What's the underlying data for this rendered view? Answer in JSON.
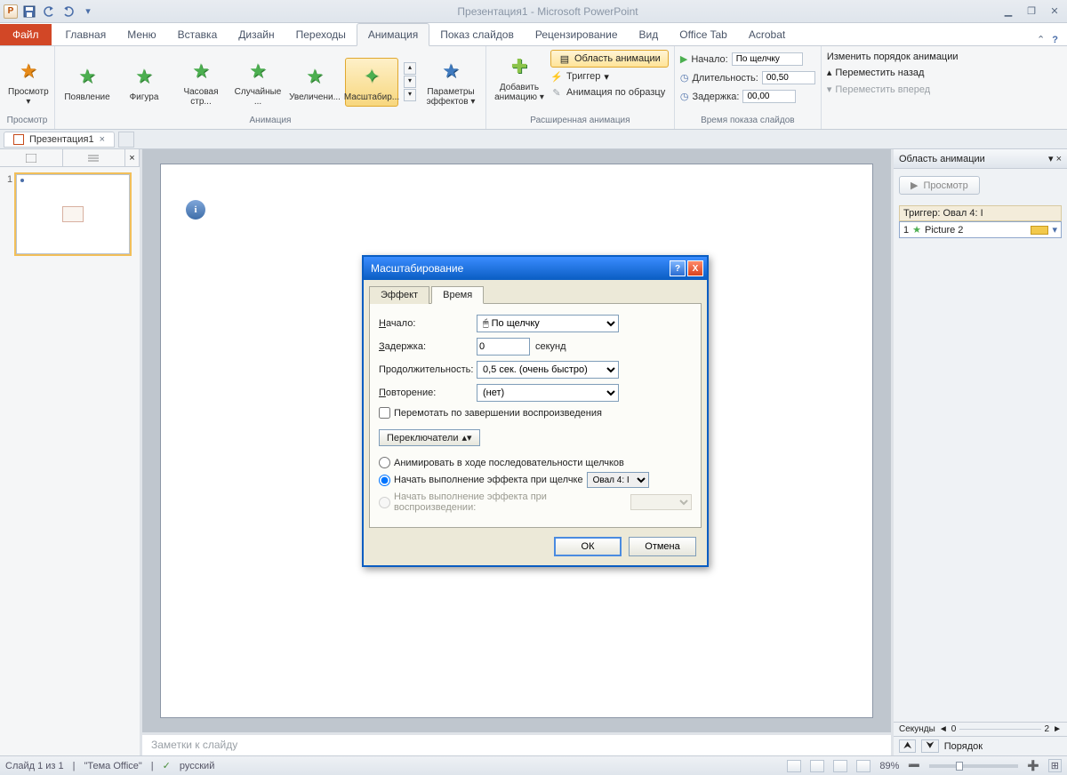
{
  "title": "Презентация1  -  Microsoft PowerPoint",
  "ribbon": {
    "file": "Файл",
    "tabs": [
      "Главная",
      "Меню",
      "Вставка",
      "Дизайн",
      "Переходы",
      "Анимация",
      "Показ слайдов",
      "Рецензирование",
      "Вид",
      "Office Tab",
      "Acrobat"
    ],
    "active_tab": "Анимация",
    "groups": {
      "preview": {
        "btn": "Просмотр",
        "title": "Просмотр"
      },
      "animation": {
        "title": "Анимация",
        "items": [
          "Появление",
          "Фигура",
          "Часовая стр...",
          "Случайные ...",
          "Увеличени...",
          "Масштабир...",
          "Параметры эффектов"
        ]
      },
      "advanced": {
        "title": "Расширенная анимация",
        "add": "Добавить анимацию",
        "pane": "Область анимации",
        "trigger": "Триггер",
        "copy": "Анимация по образцу"
      },
      "timing": {
        "title": "Время показа слайдов",
        "start_lbl": "Начало:",
        "start_val": "По щелчку",
        "duration_lbl": "Длительность:",
        "duration_val": "00,50",
        "delay_lbl": "Задержка:",
        "delay_val": "00,00"
      },
      "reorder": {
        "title": "Изменить порядок анимации",
        "back": "Переместить назад",
        "forward": "Переместить вперед"
      }
    }
  },
  "doc_tab": "Презентация1",
  "anim_pane": {
    "title": "Область анимации",
    "play": "Просмотр",
    "trigger_header": "Триггер: Овал 4: I",
    "item_index": "1",
    "item_name": "Picture 2",
    "seconds": "Секунды",
    "seconds_start": "0",
    "seconds_end": "2",
    "order": "Порядок"
  },
  "notes_placeholder": "Заметки к слайду",
  "status": {
    "slide": "Слайд 1 из 1",
    "theme": "\"Тема Office\"",
    "lang": "русский",
    "zoom": "89%"
  },
  "dialog": {
    "title": "Масштабирование",
    "tabs": [
      "Эффект",
      "Время"
    ],
    "active": 1,
    "start_lbl": "Начало:",
    "start_val": "По щелчку",
    "delay_lbl": "Задержка:",
    "delay_val": "0",
    "delay_unit": "секунд",
    "duration_lbl": "Продолжительность:",
    "duration_val": "0,5 сек. (очень быстро)",
    "repeat_lbl": "Повторение:",
    "repeat_val": "(нет)",
    "rewind": "Перемотать по завершении воспроизведения",
    "triggers_btn": "Переключатели",
    "radio1": "Анимировать в ходе последовательности щелчков",
    "radio2": "Начать выполнение эффекта при щелчке",
    "radio2_val": "Овал 4: I",
    "radio3": "Начать выполнение эффекта при воспроизведении:",
    "ok": "ОК",
    "cancel": "Отмена"
  }
}
